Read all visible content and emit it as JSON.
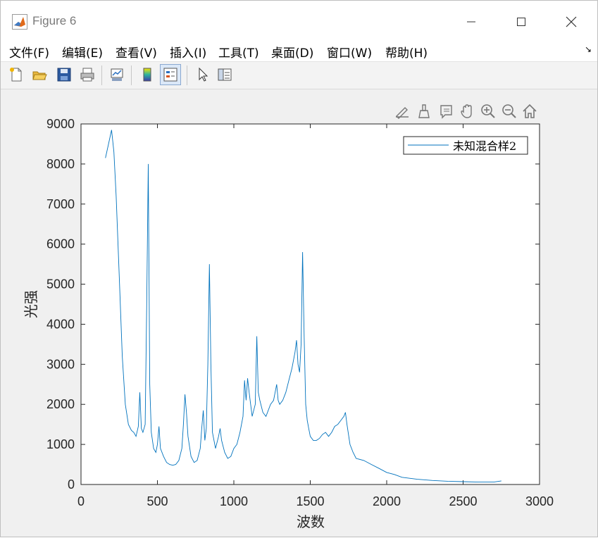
{
  "window": {
    "title": "Figure 6"
  },
  "menu": [
    {
      "label": "文件(F)"
    },
    {
      "label": "编辑(E)"
    },
    {
      "label": "查看(V)"
    },
    {
      "label": "插入(I)"
    },
    {
      "label": "工具(T)"
    },
    {
      "label": "桌面(D)"
    },
    {
      "label": "窗口(W)"
    },
    {
      "label": "帮助(H)"
    }
  ],
  "toolbar": {
    "icons": [
      "new-figure-icon",
      "open-file-icon",
      "save-icon",
      "print-icon",
      "link-plot-icon",
      "colorbar-icon",
      "legend-icon",
      "pointer-icon",
      "property-inspector-icon"
    ]
  },
  "axes_toolbar": {
    "icons": [
      "edit-plot-icon",
      "brush-icon",
      "data-tips-icon",
      "pan-icon",
      "zoom-in-icon",
      "zoom-out-icon",
      "home-icon"
    ]
  },
  "chart_data": {
    "type": "line",
    "xlabel": "波数",
    "ylabel": "光强",
    "xlim": [
      0,
      3000
    ],
    "ylim": [
      0,
      9000
    ],
    "xticks": [
      "0",
      "500",
      "1000",
      "1500",
      "2000",
      "2500",
      "3000"
    ],
    "yticks": [
      "0",
      "1000",
      "2000",
      "3000",
      "4000",
      "5000",
      "6000",
      "7000",
      "8000",
      "9000"
    ],
    "legend_position": "top-right",
    "grid": false,
    "color": "#0072bd",
    "series": [
      {
        "name": "未知混合样2",
        "x": [
          160,
          180,
          200,
          215,
          230,
          250,
          270,
          290,
          310,
          330,
          345,
          360,
          375,
          385,
          395,
          405,
          420,
          430,
          440,
          450,
          460,
          475,
          490,
          500,
          510,
          520,
          540,
          560,
          580,
          600,
          620,
          640,
          660,
          670,
          680,
          690,
          700,
          720,
          740,
          760,
          780,
          790,
          800,
          810,
          820,
          830,
          840,
          850,
          860,
          880,
          900,
          910,
          920,
          940,
          960,
          980,
          1000,
          1020,
          1040,
          1060,
          1070,
          1080,
          1090,
          1100,
          1120,
          1140,
          1150,
          1160,
          1170,
          1190,
          1210,
          1240,
          1260,
          1270,
          1280,
          1290,
          1300,
          1320,
          1340,
          1360,
          1380,
          1400,
          1410,
          1420,
          1430,
          1440,
          1450,
          1460,
          1470,
          1480,
          1490,
          1500,
          1520,
          1540,
          1560,
          1580,
          1600,
          1620,
          1640,
          1660,
          1680,
          1700,
          1720,
          1730,
          1740,
          1760,
          1780,
          1800,
          1850,
          1900,
          1950,
          2000,
          2050,
          2100,
          2200,
          2300,
          2400,
          2500,
          2600,
          2700,
          2750
        ],
        "y": [
          8150,
          8500,
          8850,
          8300,
          7200,
          5200,
          3200,
          2000,
          1500,
          1350,
          1300,
          1200,
          1450,
          2300,
          1400,
          1300,
          1500,
          4500,
          8000,
          2500,
          1300,
          900,
          800,
          1000,
          1450,
          900,
          700,
          550,
          500,
          480,
          500,
          600,
          900,
          1500,
          2250,
          1800,
          1200,
          700,
          550,
          600,
          900,
          1400,
          1850,
          1100,
          1400,
          3000,
          5500,
          3000,
          1300,
          900,
          1200,
          1400,
          1100,
          800,
          650,
          700,
          900,
          1000,
          1300,
          1700,
          2600,
          2100,
          2650,
          2300,
          1700,
          2000,
          3700,
          2300,
          2100,
          1800,
          1700,
          2000,
          2100,
          2300,
          2500,
          2100,
          2000,
          2100,
          2300,
          2600,
          2900,
          3300,
          3600,
          3000,
          2800,
          3500,
          5800,
          3700,
          2000,
          1600,
          1400,
          1200,
          1100,
          1100,
          1150,
          1250,
          1300,
          1200,
          1300,
          1450,
          1500,
          1600,
          1700,
          1800,
          1500,
          1000,
          800,
          650,
          600,
          500,
          400,
          300,
          250,
          180,
          130,
          100,
          80,
          70,
          60,
          60,
          90
        ]
      }
    ]
  }
}
